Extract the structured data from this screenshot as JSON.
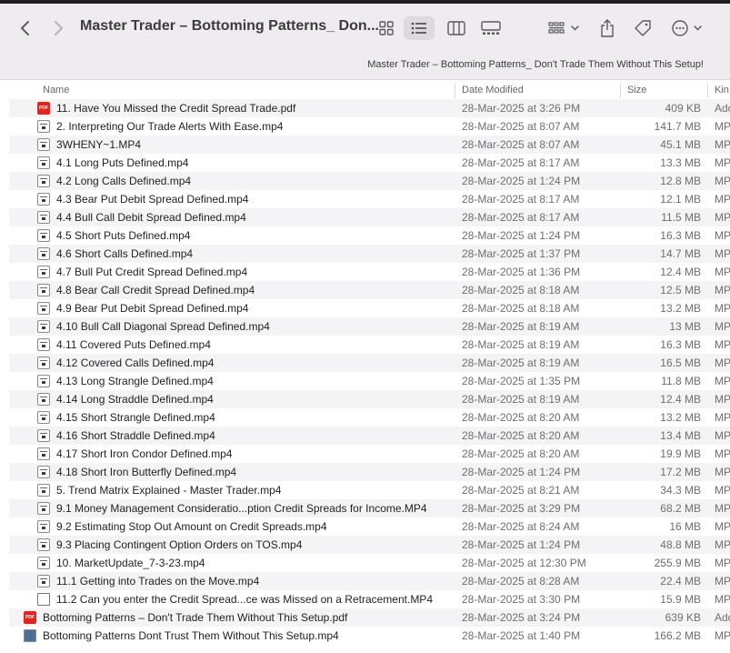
{
  "window": {
    "title": "Master Trader – Bottoming Patterns_ Don...",
    "path_bar": "Master Trader – Bottoming Patterns_ Don't Trade Them Without This Setup!"
  },
  "toolbar": {
    "icons": [
      "back-icon",
      "forward-icon",
      "icon-view-icon",
      "list-view-icon",
      "column-view-icon",
      "gallery-view-icon",
      "group-icon",
      "share-icon",
      "tag-icon",
      "more-icon"
    ]
  },
  "columns": {
    "name": "Name",
    "date": "Date Modified",
    "size": "Size",
    "kind": "Kin"
  },
  "files": [
    {
      "name": "11. Have You Missed the Credit Spread Trade.pdf",
      "date": "28-Mar-2025 at 3:26 PM",
      "size": "409 KB",
      "kind": "Ado",
      "icon": "pdf",
      "indent": true
    },
    {
      "name": "2. Interpreting Our Trade Alerts With Ease.mp4",
      "date": "28-Mar-2025 at 8:07 AM",
      "size": "141.7 MB",
      "kind": "MP",
      "icon": "video",
      "indent": true
    },
    {
      "name": "3WHENY~1.MP4",
      "date": "28-Mar-2025 at 8:07 AM",
      "size": "45.1 MB",
      "kind": "MP",
      "icon": "video",
      "indent": true
    },
    {
      "name": "4.1 Long Puts Defined.mp4",
      "date": "28-Mar-2025 at 8:17 AM",
      "size": "13.3 MB",
      "kind": "MP",
      "icon": "video",
      "indent": true
    },
    {
      "name": "4.2 Long Calls Defined.mp4",
      "date": "28-Mar-2025 at 1:24 PM",
      "size": "12.8 MB",
      "kind": "MP",
      "icon": "video",
      "indent": true
    },
    {
      "name": "4.3 Bear Put Debit Spread Defined.mp4",
      "date": "28-Mar-2025 at 8:17 AM",
      "size": "12.1 MB",
      "kind": "MP",
      "icon": "video",
      "indent": true
    },
    {
      "name": "4.4 Bull Call Debit Spread Defined.mp4",
      "date": "28-Mar-2025 at 8:17 AM",
      "size": "11.5 MB",
      "kind": "MP",
      "icon": "video",
      "indent": true
    },
    {
      "name": "4.5 Short Puts Defined.mp4",
      "date": "28-Mar-2025 at 1:24 PM",
      "size": "16.3 MB",
      "kind": "MP",
      "icon": "video",
      "indent": true
    },
    {
      "name": "4.6 Short Calls Defined.mp4",
      "date": "28-Mar-2025 at 1:37 PM",
      "size": "14.7 MB",
      "kind": "MP",
      "icon": "video",
      "indent": true
    },
    {
      "name": "4.7 Bull Put Credit Spread Defined.mp4",
      "date": "28-Mar-2025 at 1:36 PM",
      "size": "12.4 MB",
      "kind": "MP",
      "icon": "video",
      "indent": true
    },
    {
      "name": "4.8 Bear Call Credit Spread Defined.mp4",
      "date": "28-Mar-2025 at 8:18 AM",
      "size": "12.5 MB",
      "kind": "MP",
      "icon": "video",
      "indent": true
    },
    {
      "name": "4.9 Bear Put Debit Spread Defined.mp4",
      "date": "28-Mar-2025 at 8:18 AM",
      "size": "13.2 MB",
      "kind": "MP",
      "icon": "video",
      "indent": true
    },
    {
      "name": "4.10 Bull Call Diagonal Spread Defined.mp4",
      "date": "28-Mar-2025 at 8:19 AM",
      "size": "13 MB",
      "kind": "MP",
      "icon": "video",
      "indent": true
    },
    {
      "name": "4.11 Covered Puts Defined.mp4",
      "date": "28-Mar-2025 at 8:19 AM",
      "size": "16.3 MB",
      "kind": "MP",
      "icon": "video",
      "indent": true
    },
    {
      "name": "4.12 Covered Calls Defined.mp4",
      "date": "28-Mar-2025 at 8:19 AM",
      "size": "16.5 MB",
      "kind": "MP",
      "icon": "video",
      "indent": true
    },
    {
      "name": "4.13 Long Strangle Defined.mp4",
      "date": "28-Mar-2025 at 1:35 PM",
      "size": "11.8 MB",
      "kind": "MP",
      "icon": "video",
      "indent": true
    },
    {
      "name": "4.14 Long Straddle Defined.mp4",
      "date": "28-Mar-2025 at 8:19 AM",
      "size": "12.4 MB",
      "kind": "MP",
      "icon": "video",
      "indent": true
    },
    {
      "name": "4.15 Short Strangle Defined.mp4",
      "date": "28-Mar-2025 at 8:20 AM",
      "size": "13.2 MB",
      "kind": "MP",
      "icon": "video",
      "indent": true
    },
    {
      "name": "4.16 Short Straddle Defined.mp4",
      "date": "28-Mar-2025 at 8:20 AM",
      "size": "13.4 MB",
      "kind": "MP",
      "icon": "video",
      "indent": true
    },
    {
      "name": "4.17 Short Iron Condor Defined.mp4",
      "date": "28-Mar-2025 at 8:20 AM",
      "size": "19.9 MB",
      "kind": "MP",
      "icon": "video",
      "indent": true
    },
    {
      "name": "4.18 Short Iron Butterfly Defined.mp4",
      "date": "28-Mar-2025 at 1:24 PM",
      "size": "17.2 MB",
      "kind": "MP",
      "icon": "video",
      "indent": true
    },
    {
      "name": "5. Trend Matrix Explained - Master Trader.mp4",
      "date": "28-Mar-2025 at 8:21 AM",
      "size": "34.3 MB",
      "kind": "MP",
      "icon": "video",
      "indent": true
    },
    {
      "name": "9.1 Money Management Consideratio...ption Credit Spreads for Income.MP4",
      "date": "28-Mar-2025 at 3:29 PM",
      "size": "68.2 MB",
      "kind": "MP",
      "icon": "video",
      "indent": true
    },
    {
      "name": "9.2 Estimating Stop Out Amount on Credit Spreads.mp4",
      "date": "28-Mar-2025 at 8:24 AM",
      "size": "16 MB",
      "kind": "MP",
      "icon": "video",
      "indent": true
    },
    {
      "name": "9.3 Placing Contingent Option Orders on TOS.mp4",
      "date": "28-Mar-2025 at 1:24 PM",
      "size": "48.8 MB",
      "kind": "MP",
      "icon": "video",
      "indent": true
    },
    {
      "name": "10. MarketUpdate_7-3-23.mp4",
      "date": "28-Mar-2025 at 12:30 PM",
      "size": "255.9 MB",
      "kind": "MP",
      "icon": "video",
      "indent": true
    },
    {
      "name": "11.1 Getting into Trades on the Move.mp4",
      "date": "28-Mar-2025 at 8:28 AM",
      "size": "22.4 MB",
      "kind": "MP",
      "icon": "video",
      "indent": true
    },
    {
      "name": "11.2 Can you enter the Credit Spread...ce was Missed on a Retracement.MP4",
      "date": "28-Mar-2025 at 3:30 PM",
      "size": "15.9 MB",
      "kind": "MP",
      "icon": "doc",
      "indent": true
    },
    {
      "name": "Bottoming Patterns – Don't Trade Them Without This Setup.pdf",
      "date": "28-Mar-2025 at 3:24 PM",
      "size": "639 KB",
      "kind": "Ado",
      "icon": "pdf",
      "indent": false
    },
    {
      "name": "Bottoming Patterns Dont Trust Them Without This Setup.mp4",
      "date": "28-Mar-2025 at 1:40 PM",
      "size": "166.2 MB",
      "kind": "MP",
      "icon": "thumb",
      "indent": false
    }
  ]
}
